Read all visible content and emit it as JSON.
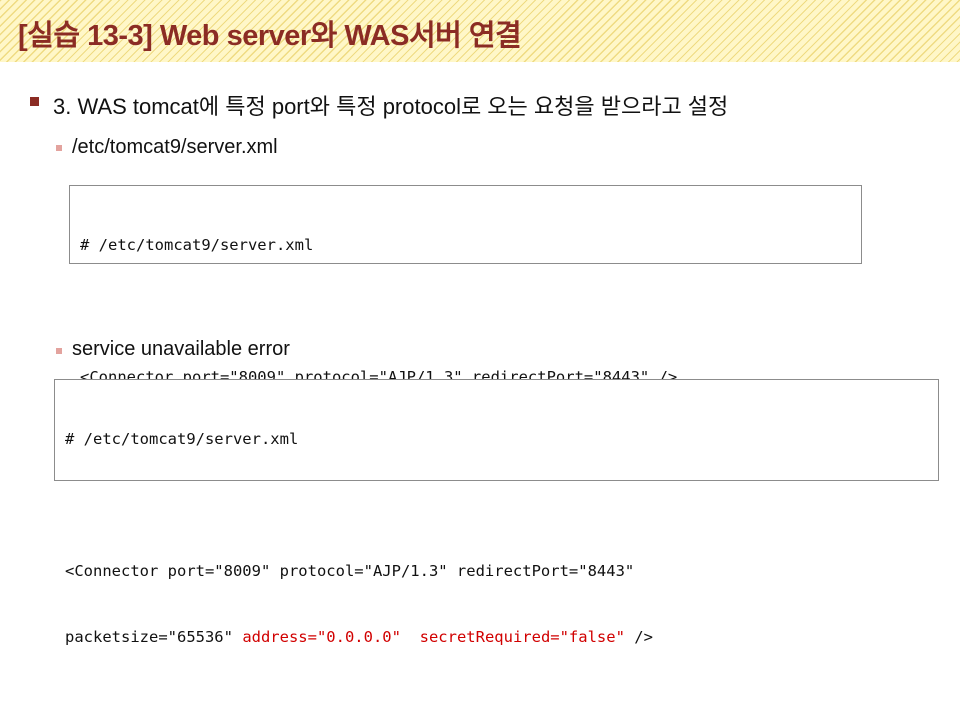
{
  "slide": {
    "title": "[실습 13-3] Web server와 WAS서버 연결",
    "main_bullet": "3. WAS tomcat에 특정 port와 특정 protocol로 오는 요청을 받으라고 설정",
    "sections": [
      {
        "label": "/etc/tomcat9/server.xml",
        "code": {
          "comment": "# /etc/tomcat9/server.xml",
          "line1": "<Connector port=\"8009\" protocol=\"AJP/1.3\" redirectPort=\"8443\" />"
        }
      },
      {
        "label": "service unavailable error",
        "code": {
          "comment": "# /etc/tomcat9/server.xml",
          "line1": "<Connector port=\"8009\" protocol=\"AJP/1.3\" redirectPort=\"8443\"",
          "line2_start": "packetsize=\"65536\" ",
          "line2_address": "address=\"0.0.0.0\"",
          "line2_gap": "  ",
          "line2_secret": "secretRequired=\"false\"",
          "line2_end": " />"
        }
      }
    ]
  },
  "colors": {
    "title": "#8b2c24",
    "title_background": "#fff7c8",
    "stripe": "#e2c448",
    "bullet_primary": "#8b2c24",
    "bullet_secondary": "#e3a39e",
    "highlight": "#d10000",
    "code_border": "#8c8c8c"
  }
}
